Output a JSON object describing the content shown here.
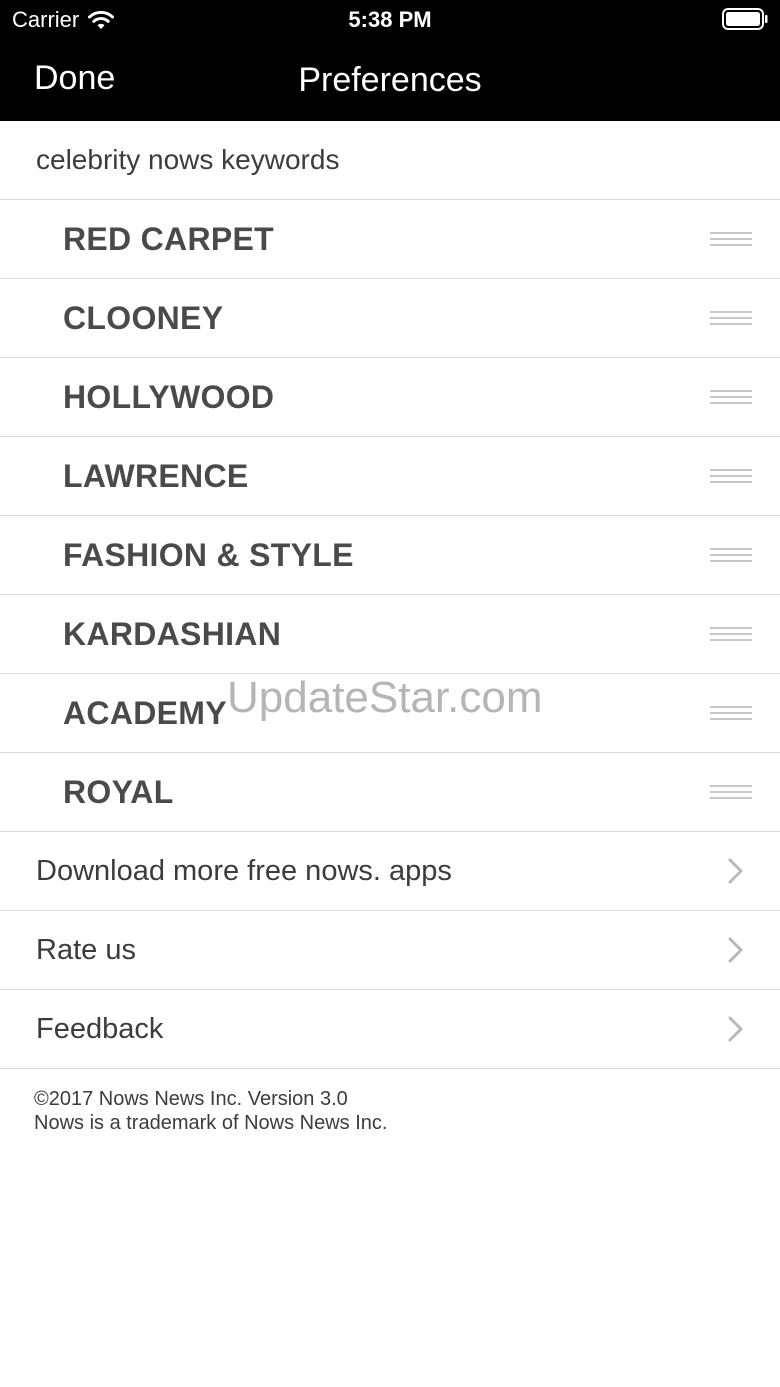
{
  "status_bar": {
    "carrier": "Carrier",
    "time": "5:38 PM",
    "icons": [
      "wifi-icon",
      "battery-icon"
    ]
  },
  "nav_bar": {
    "done_label": "Done",
    "title": "Preferences"
  },
  "section": {
    "header": "celebrity nows keywords"
  },
  "keywords": [
    "RED CARPET",
    "CLOONEY",
    "HOLLYWOOD",
    "LAWRENCE",
    "FASHION & STYLE",
    "KARDASHIAN",
    "ACADEMY",
    "ROYAL"
  ],
  "links": [
    "Download more free nows. apps",
    "Rate us",
    "Feedback"
  ],
  "footer": {
    "line1": "©2017 Nows News Inc. Version 3.0",
    "line2": "Nows is a trademark of Nows News Inc."
  },
  "watermark": "UpdateStar.com",
  "colors": {
    "nav_background": "#000000",
    "text": "#3c3c3c",
    "separator": "#d9d9d9"
  }
}
